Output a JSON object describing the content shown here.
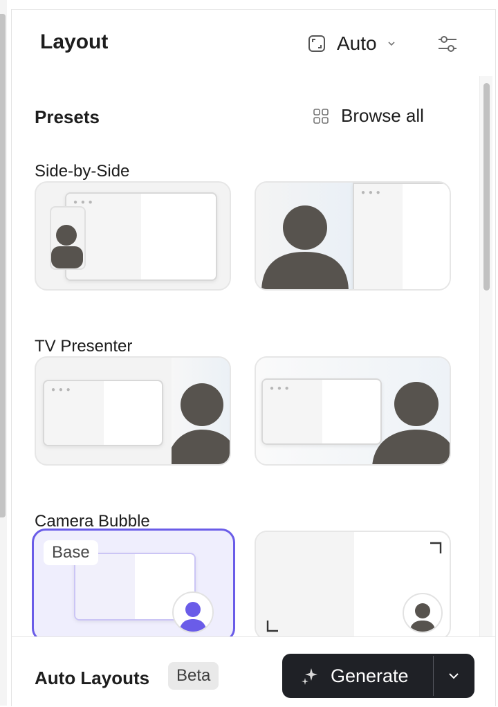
{
  "header": {
    "title": "Layout",
    "aspect_select_label": "Auto",
    "aspect_icon": "aspect-ratio-icon",
    "settings_icon": "sliders-icon"
  },
  "presets": {
    "heading": "Presets",
    "browse_all_label": "Browse all",
    "browse_icon": "grid-icon"
  },
  "sections": [
    {
      "label": "Side-by-Side"
    },
    {
      "label": "TV Presenter"
    },
    {
      "label": "Camera Bubble",
      "selected_badge": "Base"
    }
  ],
  "footer": {
    "title": "Auto Layouts",
    "badge": "Beta",
    "generate_label": "Generate",
    "generate_icon": "sparkle-icon"
  },
  "colors": {
    "accent": "#6a5ce8",
    "avatar": "#57534e",
    "button_dark": "#1f2126"
  }
}
